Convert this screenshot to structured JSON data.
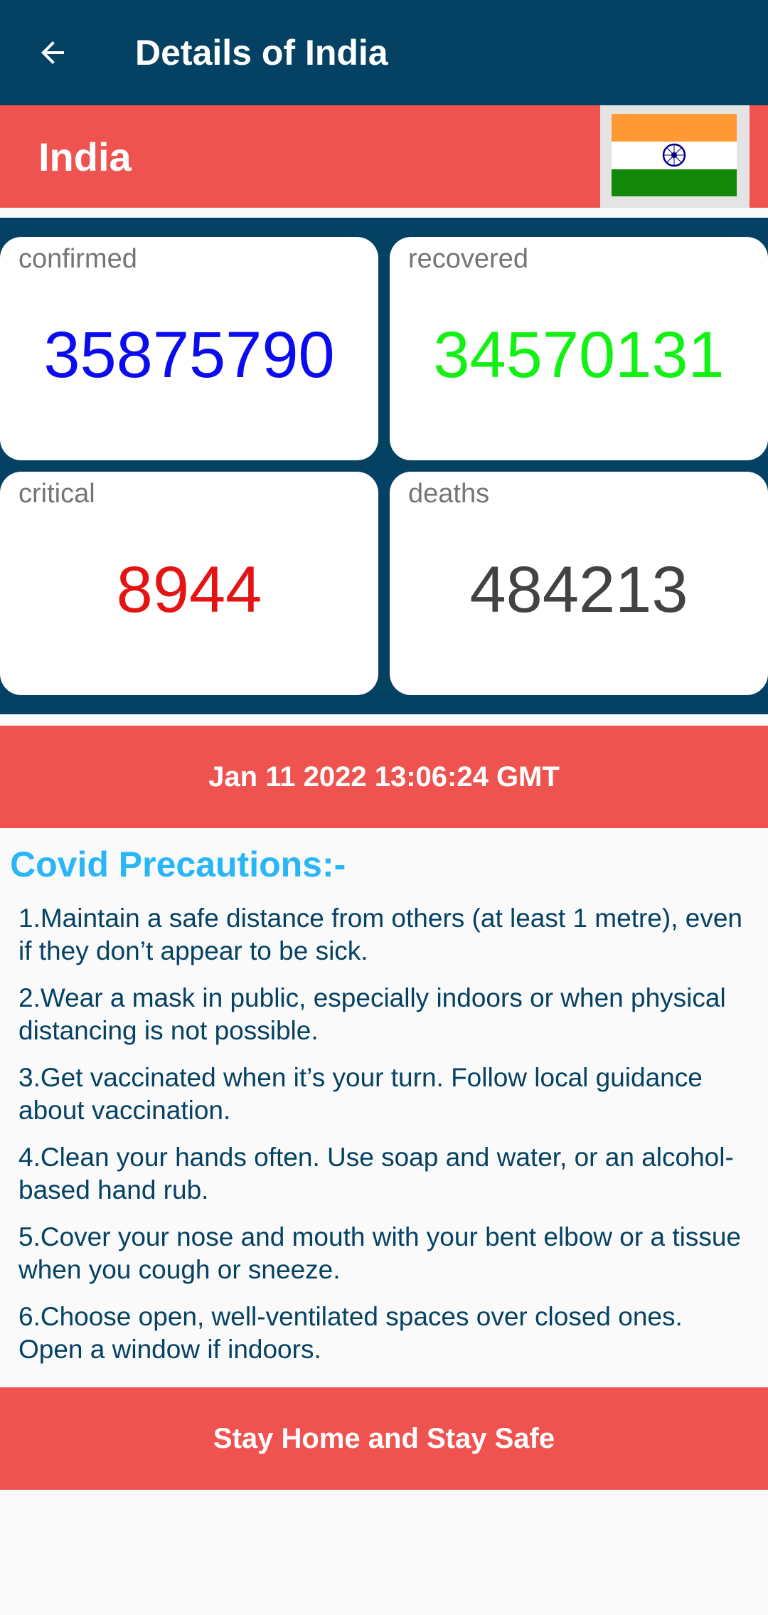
{
  "appbar": {
    "title": "Details of India",
    "back_icon": "arrow-left-icon"
  },
  "country": {
    "name": "India",
    "flag_icon": "india-flag-icon"
  },
  "stats": [
    {
      "label": "confirmed",
      "value": "35875790",
      "color": "#0b0bf0"
    },
    {
      "label": "recovered",
      "value": "34570131",
      "color": "#13f013"
    },
    {
      "label": "critical",
      "value": "8944",
      "color": "#e51414"
    },
    {
      "label": "deaths",
      "value": "484213",
      "color": "#424242"
    }
  ],
  "updated": "Jan 11 2022 13:06:24 GMT",
  "precautions": {
    "title": "Covid Precautions:-",
    "items": [
      "1.Maintain a safe distance from others (at least 1 metre), even if they don’t appear to be sick.",
      "2.Wear a mask in public, especially indoors or when physical distancing is not possible.",
      "3.Get vaccinated when it’s your turn. Follow local guidance about vaccination.",
      "4.Clean your hands often. Use soap and water, or an alcohol-based hand rub.",
      "5.Cover your nose and mouth with your bent elbow or a tissue when you cough or sneeze.",
      "6.Choose open, well-ventilated spaces over closed ones. Open a window if indoors."
    ]
  },
  "footer": "Stay Home and Stay Safe",
  "colors": {
    "primary": "#044163",
    "accent": "#ef5350",
    "title": "#29b6f6"
  }
}
